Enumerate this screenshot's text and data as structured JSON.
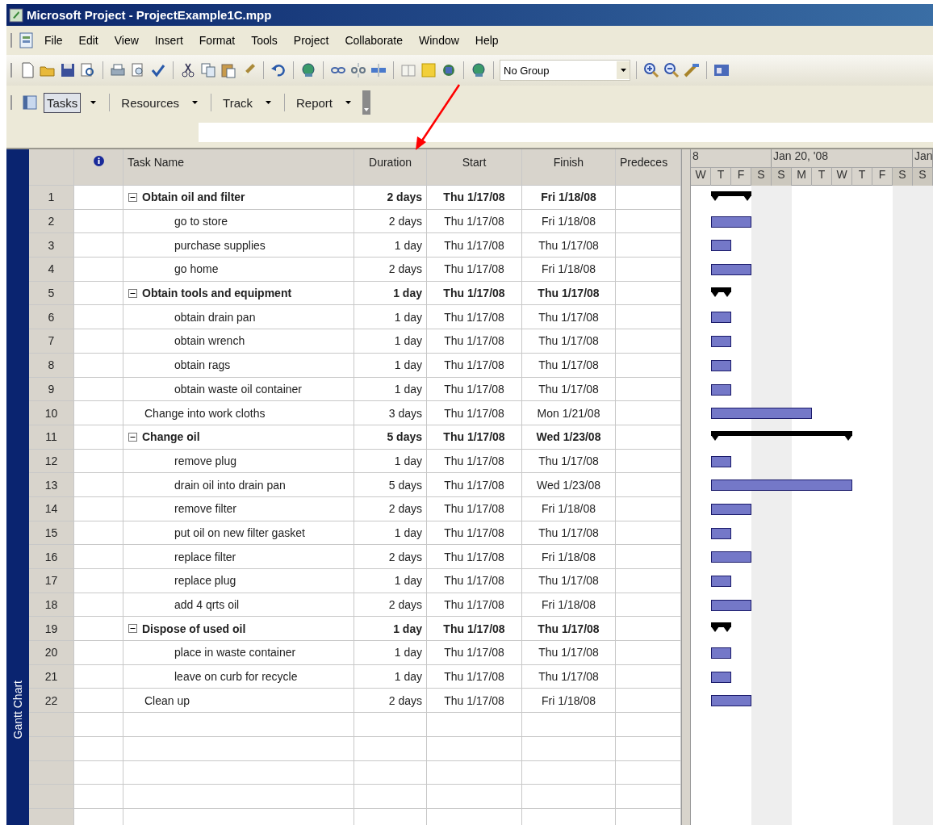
{
  "window": {
    "title": "Microsoft Project - ProjectExample1C.mpp"
  },
  "menu": [
    "File",
    "Edit",
    "View",
    "Insert",
    "Format",
    "Tools",
    "Project",
    "Collaborate",
    "Window",
    "Help"
  ],
  "toolbar": {
    "group_dropdown": "No Group"
  },
  "view_bar": [
    {
      "label": "Tasks",
      "selected": true
    },
    {
      "label": "Resources",
      "selected": false
    },
    {
      "label": "Track",
      "selected": false
    },
    {
      "label": "Report",
      "selected": false
    }
  ],
  "side_label": "Gantt Chart",
  "table": {
    "columns": [
      "Task Name",
      "Duration",
      "Start",
      "Finish",
      "Predeces"
    ],
    "tasks": [
      {
        "id": "1",
        "name": "Obtain oil and filter",
        "duration": "2 days",
        "start": "Thu 1/17/08",
        "finish": "Fri 1/18/08",
        "expanded": true,
        "children": [
          {
            "id": "2",
            "name": "go to store",
            "duration": "2 days",
            "start": "Thu 1/17/08",
            "finish": "Fri 1/18/08"
          },
          {
            "id": "3",
            "name": "purchase supplies",
            "duration": "1 day",
            "start": "Thu 1/17/08",
            "finish": "Thu 1/17/08"
          },
          {
            "id": "4",
            "name": "go home",
            "duration": "2 days",
            "start": "Thu 1/17/08",
            "finish": "Fri 1/18/08"
          }
        ]
      },
      {
        "id": "5",
        "name": "Obtain tools and equipment",
        "duration": "1 day",
        "start": "Thu 1/17/08",
        "finish": "Thu 1/17/08",
        "expanded": true,
        "children": [
          {
            "id": "6",
            "name": "obtain drain pan",
            "duration": "1 day",
            "start": "Thu 1/17/08",
            "finish": "Thu 1/17/08"
          },
          {
            "id": "7",
            "name": "obtain wrench",
            "duration": "1 day",
            "start": "Thu 1/17/08",
            "finish": "Thu 1/17/08"
          },
          {
            "id": "8",
            "name": "obtain rags",
            "duration": "1 day",
            "start": "Thu 1/17/08",
            "finish": "Thu 1/17/08"
          },
          {
            "id": "9",
            "name": "obtain waste oil container",
            "duration": "1 day",
            "start": "Thu 1/17/08",
            "finish": "Thu 1/17/08"
          }
        ]
      },
      {
        "id": "10",
        "name": "Change into work cloths",
        "duration": "3 days",
        "start": "Thu 1/17/08",
        "finish": "Mon 1/21/08"
      },
      {
        "id": "11",
        "name": "Change oil",
        "duration": "5 days",
        "start": "Thu 1/17/08",
        "finish": "Wed 1/23/08",
        "expanded": true,
        "children": [
          {
            "id": "12",
            "name": "remove plug",
            "duration": "1 day",
            "start": "Thu 1/17/08",
            "finish": "Thu 1/17/08"
          },
          {
            "id": "13",
            "name": "drain oil into drain pan",
            "duration": "5 days",
            "start": "Thu 1/17/08",
            "finish": "Wed 1/23/08"
          },
          {
            "id": "14",
            "name": "remove filter",
            "duration": "2 days",
            "start": "Thu 1/17/08",
            "finish": "Fri 1/18/08"
          },
          {
            "id": "15",
            "name": "put oil on new filter gasket",
            "duration": "1 day",
            "start": "Thu 1/17/08",
            "finish": "Thu 1/17/08"
          },
          {
            "id": "16",
            "name": "replace filter",
            "duration": "2 days",
            "start": "Thu 1/17/08",
            "finish": "Fri 1/18/08"
          },
          {
            "id": "17",
            "name": "replace plug",
            "duration": "1 day",
            "start": "Thu 1/17/08",
            "finish": "Thu 1/17/08"
          },
          {
            "id": "18",
            "name": "add 4 qrts oil",
            "duration": "2 days",
            "start": "Thu 1/17/08",
            "finish": "Fri 1/18/08"
          }
        ]
      },
      {
        "id": "19",
        "name": "Dispose of used oil",
        "duration": "1 day",
        "start": "Thu 1/17/08",
        "finish": "Thu 1/17/08",
        "expanded": true,
        "children": [
          {
            "id": "20",
            "name": "place in waste container",
            "duration": "1 day",
            "start": "Thu 1/17/08",
            "finish": "Thu 1/17/08"
          },
          {
            "id": "21",
            "name": "leave on curb for recycle",
            "duration": "1 day",
            "start": "Thu 1/17/08",
            "finish": "Thu 1/17/08"
          }
        ]
      },
      {
        "id": "22",
        "name": "Clean up",
        "duration": "2 days",
        "start": "Thu 1/17/08",
        "finish": "Fri 1/18/08"
      }
    ]
  },
  "timescale": {
    "weeks": [
      {
        "label": "8",
        "days": [
          {
            "letter": "W",
            "weekend": false
          },
          {
            "letter": "T",
            "weekend": false
          },
          {
            "letter": "F",
            "weekend": false
          },
          {
            "letter": "S",
            "weekend": true
          }
        ]
      },
      {
        "label": "Jan 20, '08",
        "days": [
          {
            "letter": "S",
            "weekend": true
          },
          {
            "letter": "M",
            "weekend": false
          },
          {
            "letter": "T",
            "weekend": false
          },
          {
            "letter": "W",
            "weekend": false
          },
          {
            "letter": "T",
            "weekend": false
          },
          {
            "letter": "F",
            "weekend": false
          },
          {
            "letter": "S",
            "weekend": true
          }
        ]
      },
      {
        "label": "Jan",
        "days": [
          {
            "letter": "S",
            "weekend": true
          }
        ]
      }
    ]
  }
}
